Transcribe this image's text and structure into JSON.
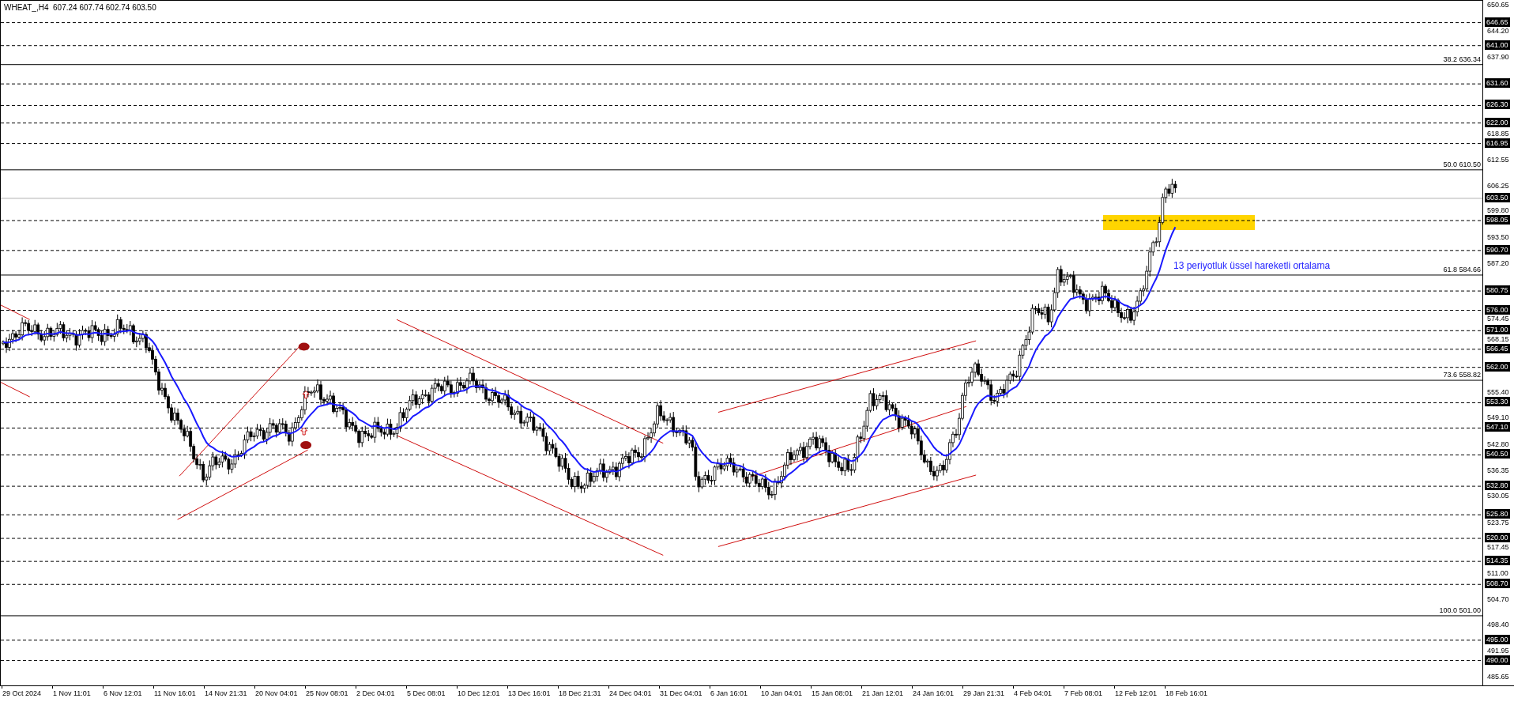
{
  "chart": {
    "title": "WHEAT_,H4  607.24 607.74 602.74 603.50",
    "annotation": "13 periyotluk üssel hareketli ortalama",
    "current_price": "603.50",
    "levels": [
      "646.65",
      "641.00",
      "631.60",
      "626.30",
      "622.00",
      "616.95",
      "598.05",
      "590.70",
      "580.75",
      "576.00",
      "571.00",
      "566.45",
      "562.00",
      "553.30",
      "547.10",
      "540.50",
      "532.80",
      "525.80",
      "520.00",
      "514.35",
      "508.70",
      "495.00",
      "490.00"
    ],
    "fibonacci": [
      {
        "ratio": "38.2",
        "price": "636.34"
      },
      {
        "ratio": "50.0",
        "price": "610.50"
      },
      {
        "ratio": "61.8",
        "price": "584.66"
      },
      {
        "ratio": "73.6",
        "price": "558.82"
      },
      {
        "ratio": "100.0",
        "price": "501.00"
      }
    ],
    "price_ticks": [
      "650.65",
      "644.20",
      "637.90",
      "618.85",
      "612.55",
      "606.25",
      "599.80",
      "593.50",
      "587.20",
      "574.45",
      "568.15",
      "555.40",
      "549.10",
      "542.80",
      "536.35",
      "530.05",
      "523.75",
      "517.45",
      "511.00",
      "504.70",
      "498.40",
      "491.95",
      "485.65"
    ],
    "time_labels": [
      "29 Oct 2024",
      "1 Nov 11:01",
      "6 Nov 12:01",
      "11 Nov 16:01",
      "14 Nov 21:31",
      "20 Nov 04:01",
      "25 Nov 08:01",
      "2 Dec 04:01",
      "5 Dec 08:01",
      "10 Dec 12:01",
      "13 Dec 16:01",
      "18 Dec 21:31",
      "24 Dec 04:01",
      "31 Dec 04:01",
      "6 Jan 16:01",
      "10 Jan 04:01",
      "15 Jan 08:01",
      "21 Jan 12:01",
      "24 Jan 16:01",
      "29 Jan 21:31",
      "4 Feb 04:01",
      "7 Feb 08:01",
      "12 Feb 12:01",
      "18 Feb 16:01"
    ]
  }
}
